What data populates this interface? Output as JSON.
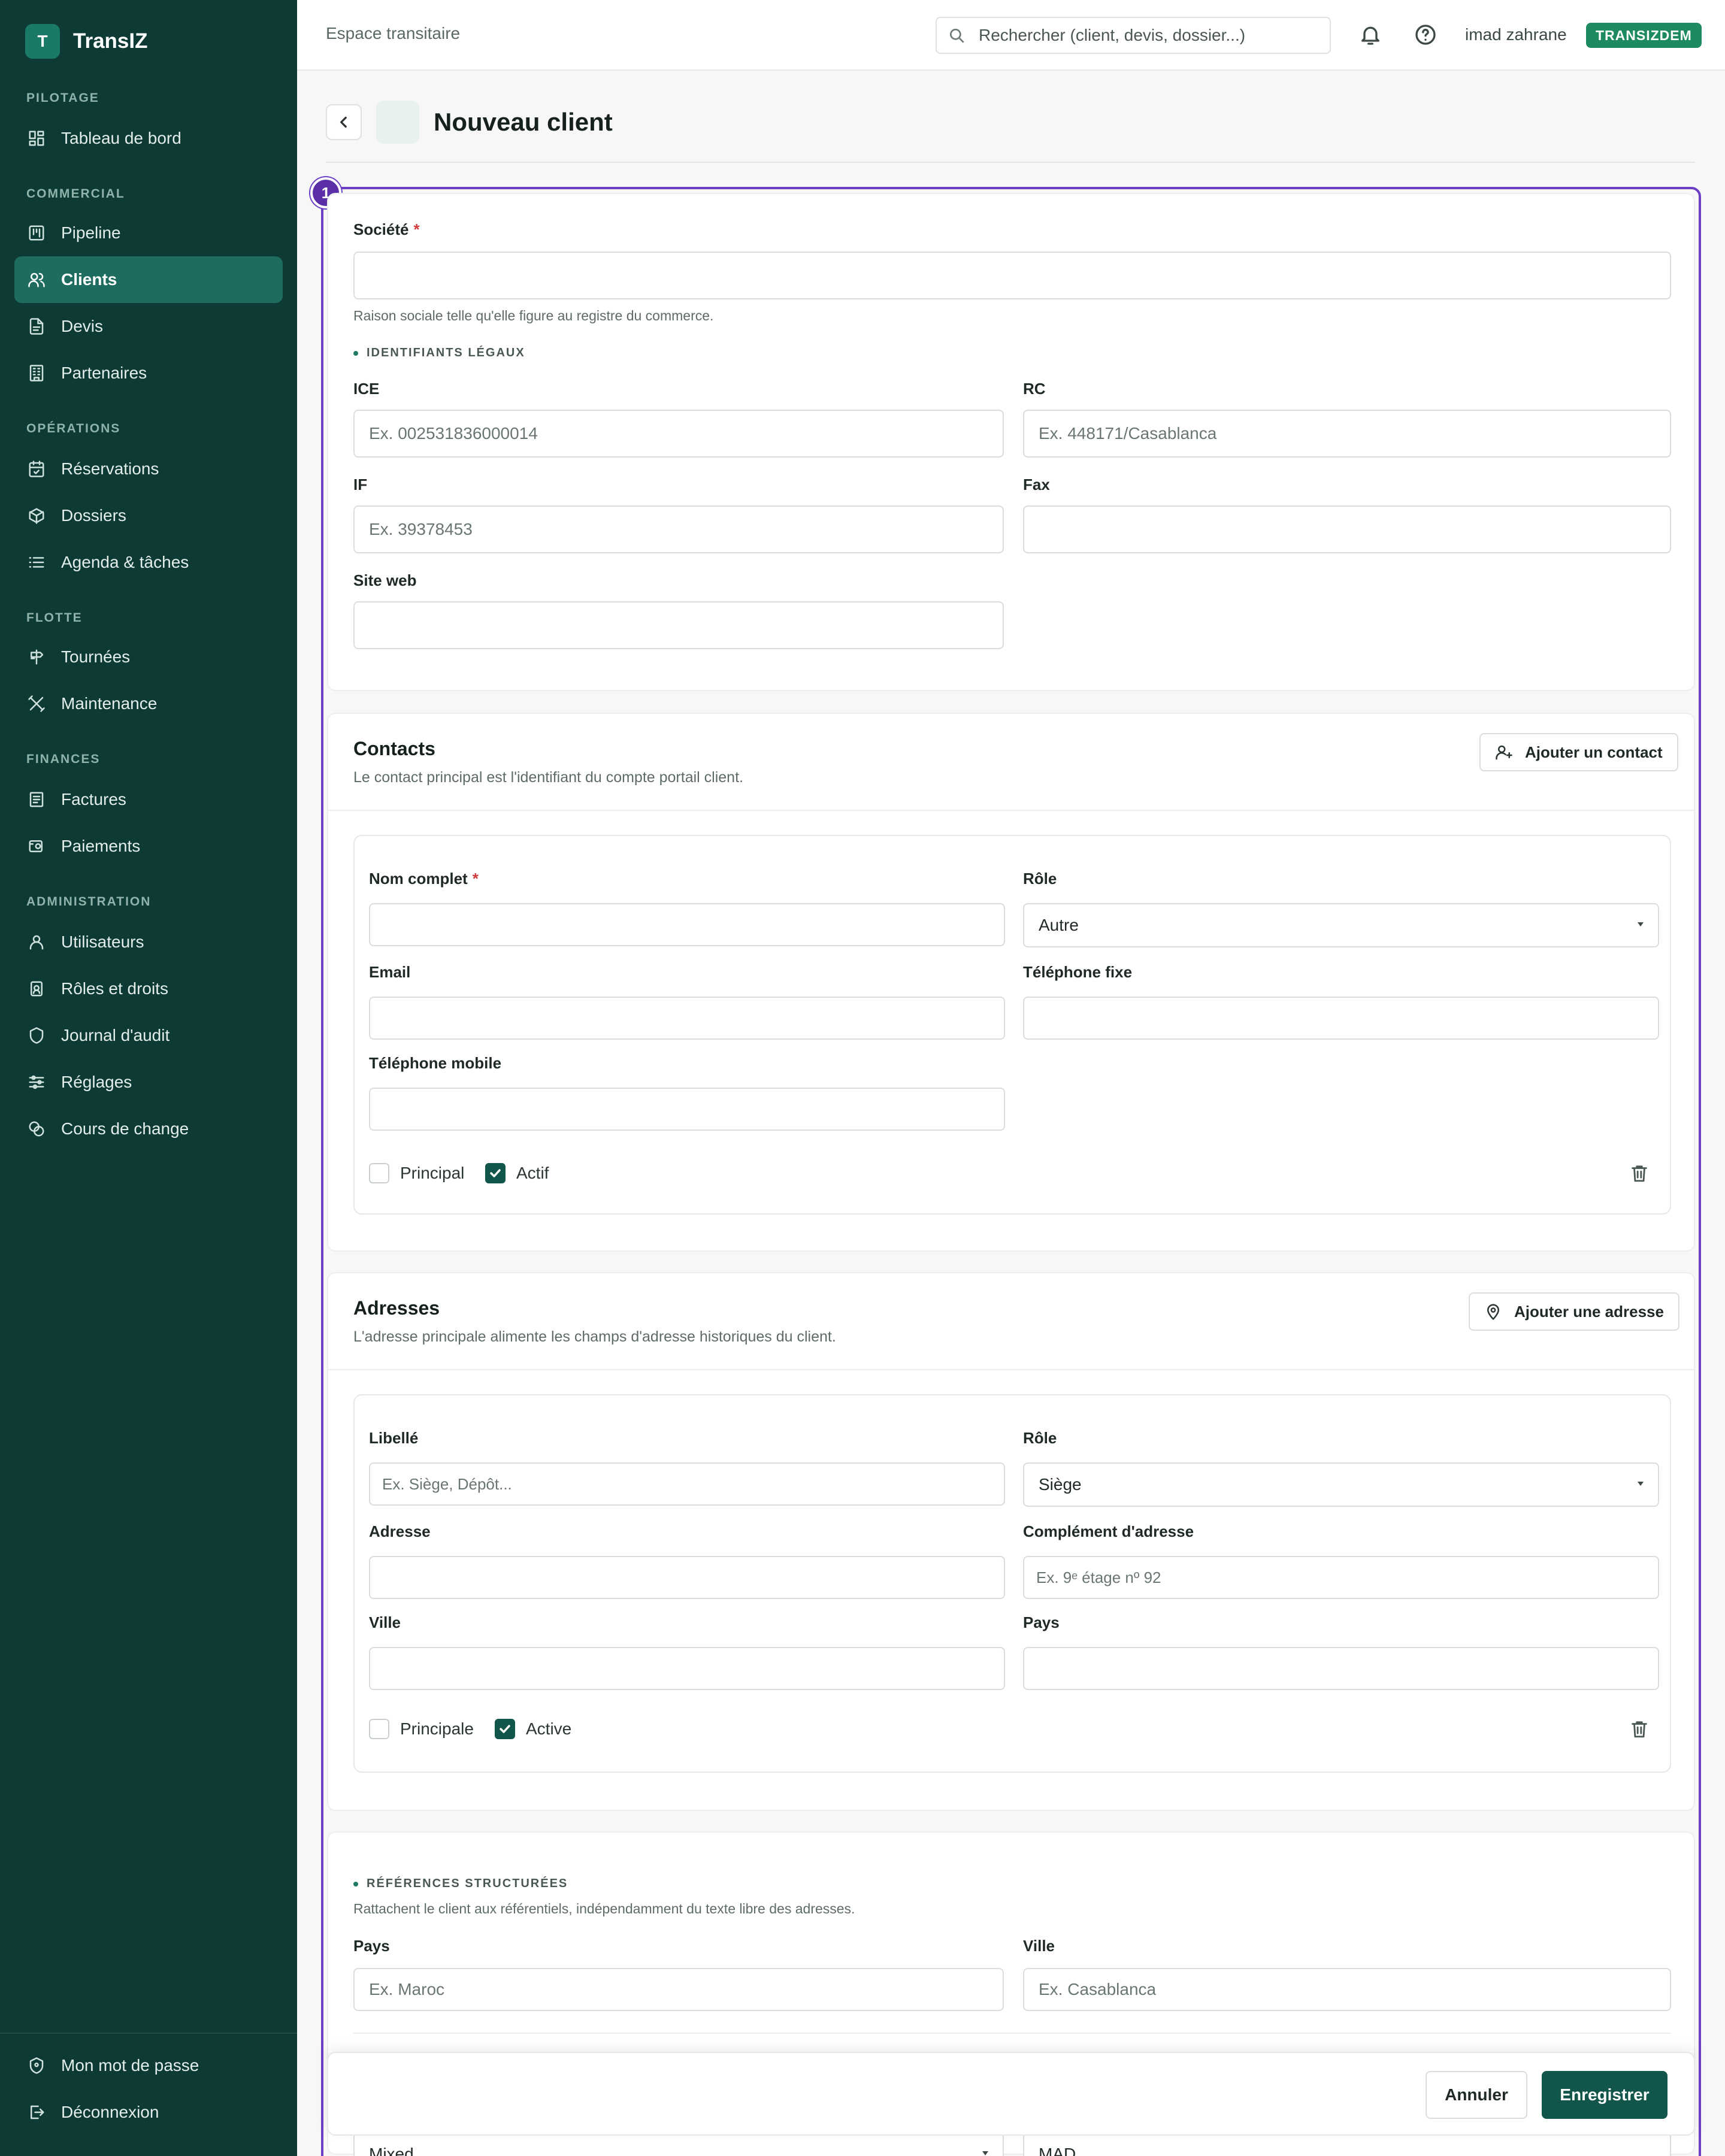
{
  "app": {
    "logo_letter": "T",
    "name": "TransIZ"
  },
  "sidebar": {
    "sections": [
      {
        "title": "PILOTAGE",
        "items": [
          {
            "label": "Tableau de bord",
            "icon": "dashboard-icon"
          }
        ]
      },
      {
        "title": "COMMERCIAL",
        "items": [
          {
            "label": "Pipeline",
            "icon": "pipeline-icon"
          },
          {
            "label": "Clients",
            "icon": "users-icon",
            "active": true
          },
          {
            "label": "Devis",
            "icon": "file-icon"
          },
          {
            "label": "Partenaires",
            "icon": "building-icon"
          }
        ]
      },
      {
        "title": "OPÉRATIONS",
        "items": [
          {
            "label": "Réservations",
            "icon": "calendar-check-icon"
          },
          {
            "label": "Dossiers",
            "icon": "package-icon"
          },
          {
            "label": "Agenda & tâches",
            "icon": "list-icon"
          }
        ]
      },
      {
        "title": "FLOTTE",
        "items": [
          {
            "label": "Tournées",
            "icon": "signpost-icon"
          },
          {
            "label": "Maintenance",
            "icon": "tools-icon"
          }
        ]
      },
      {
        "title": "FINANCES",
        "items": [
          {
            "label": "Factures",
            "icon": "receipt-icon"
          },
          {
            "label": "Paiements",
            "icon": "wallet-icon"
          }
        ]
      },
      {
        "title": "ADMINISTRATION",
        "items": [
          {
            "label": "Utilisateurs",
            "icon": "user-icon"
          },
          {
            "label": "Rôles et droits",
            "icon": "id-badge-icon"
          },
          {
            "label": "Journal d'audit",
            "icon": "shield-icon"
          },
          {
            "label": "Réglages",
            "icon": "sliders-icon"
          },
          {
            "label": "Cours de change",
            "icon": "coins-icon"
          }
        ]
      }
    ],
    "footer": [
      {
        "label": "Mon mot de passe",
        "icon": "shield-key-icon"
      },
      {
        "label": "Déconnexion",
        "icon": "logout-icon"
      }
    ]
  },
  "topbar": {
    "breadcrumb": "Espace transitaire",
    "search_placeholder": "Rechercher (client, devis, dossier...)",
    "user_name": "imad zahrane",
    "tenant_badge": "TRANSIZDEM"
  },
  "page": {
    "title": "Nouveau client",
    "step_number": "1"
  },
  "company": {
    "societe_label": "Société",
    "societe_help": "Raison sociale telle qu'elle figure au registre du commerce.",
    "legal_heading": "IDENTIFIANTS LÉGAUX",
    "ice_label": "ICE",
    "ice_placeholder": "Ex. 002531836000014",
    "rc_label": "RC",
    "rc_placeholder": "Ex. 448171/Casablanca",
    "if_label": "IF",
    "if_placeholder": "Ex. 39378453",
    "fax_label": "Fax",
    "site_label": "Site web"
  },
  "contacts": {
    "title": "Contacts",
    "subtitle": "Le contact principal est l'identifiant du compte portail client.",
    "add_button": "Ajouter un contact",
    "name_label": "Nom complet",
    "role_label": "Rôle",
    "role_value": "Autre",
    "email_label": "Email",
    "phone_label": "Téléphone fixe",
    "mobile_label": "Téléphone mobile",
    "principal_label": "Principal",
    "principal_checked": false,
    "actif_label": "Actif",
    "actif_checked": true
  },
  "addresses": {
    "title": "Adresses",
    "subtitle": "L'adresse principale alimente les champs d'adresse historiques du client.",
    "add_button": "Ajouter une adresse",
    "libelle_label": "Libellé",
    "libelle_placeholder": "Ex. Siège, Dépôt...",
    "role_label": "Rôle",
    "role_value": "Siège",
    "adresse_label": "Adresse",
    "complement_label": "Complément d'adresse",
    "complement_placeholder": "Ex. 9ᵉ étage nº 92",
    "ville_label": "Ville",
    "pays_label": "Pays",
    "principale_label": "Principale",
    "principale_checked": false,
    "active_label": "Active",
    "active_checked": true
  },
  "references": {
    "heading": "RÉFÉRENCES STRUCTURÉES",
    "help": "Rattachent le client aux référentiels, indépendamment du texte libre des adresses.",
    "pays_label": "Pays",
    "pays_placeholder": "Ex. Maroc",
    "ville_label": "Ville",
    "ville_placeholder": "Ex. Casablanca",
    "partial_select_value": "Mixed",
    "partial_currency_value": "MAD"
  },
  "actions": {
    "cancel": "Annuler",
    "save": "Enregistrer"
  },
  "colors": {
    "sidebar_bg": "#0d3a34",
    "active_item": "#1e6c5f",
    "primary": "#12564b",
    "badge": "#1e8a5f",
    "step_outline": "#6b3fc4",
    "required": "#d23b3b"
  }
}
